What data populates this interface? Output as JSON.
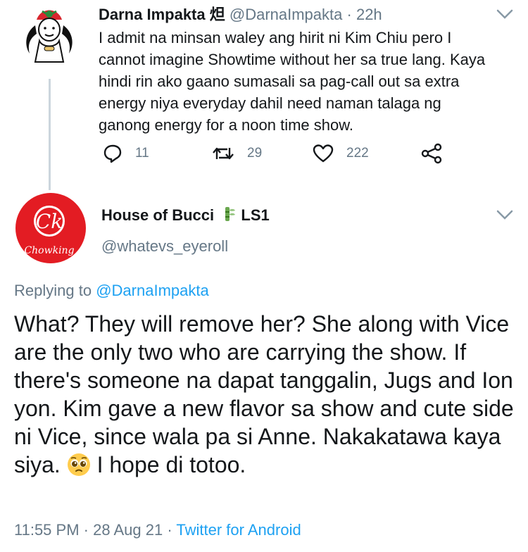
{
  "tweet1": {
    "display_name": "Darna Impakta 炟",
    "handle": "@DarnaImpakta",
    "separator": "·",
    "time": "22h",
    "text": "I admit na minsan waley ang hirit ni Kim Chiu pero I\ncannot imagine Showtime without her sa true lang. Kaya\nhindi rin ako gaano sumasali sa pag-call out sa extra\nenergy niya everyday dahil need naman talaga ng\nganong energy for a noon time show.",
    "actions": {
      "reply_count": "11",
      "retweet_count": "29",
      "like_count": "222"
    }
  },
  "tweet2": {
    "display_name": "House of Bucci",
    "name_badge": "LS1",
    "handle": "@whatevs_eyeroll",
    "avatar_text_main": "Ck",
    "avatar_text_sub": "Chowking",
    "replying_prefix": "Replying to",
    "replying_handle": "@DarnaImpakta",
    "text_before_emoji": "What? They will remove her? She along with Vice are the only two who are carrying the show. If there's someone na dapat tanggalin, Jugs and Ion yon. Kim gave a new flavor sa show and cute side ni Vice, since wala pa si Anne. Nakakatawa kaya siya. ",
    "emoji": "pleading-face-emoji",
    "text_after_emoji": " I hope di totoo.",
    "time": "11:55 PM",
    "date": "28 Aug 21",
    "separator": "·",
    "source": "Twitter for Android"
  },
  "colors": {
    "link": "#1da1f2",
    "muted": "#657786",
    "text": "#14171a",
    "chowking_red": "#e31c23"
  }
}
